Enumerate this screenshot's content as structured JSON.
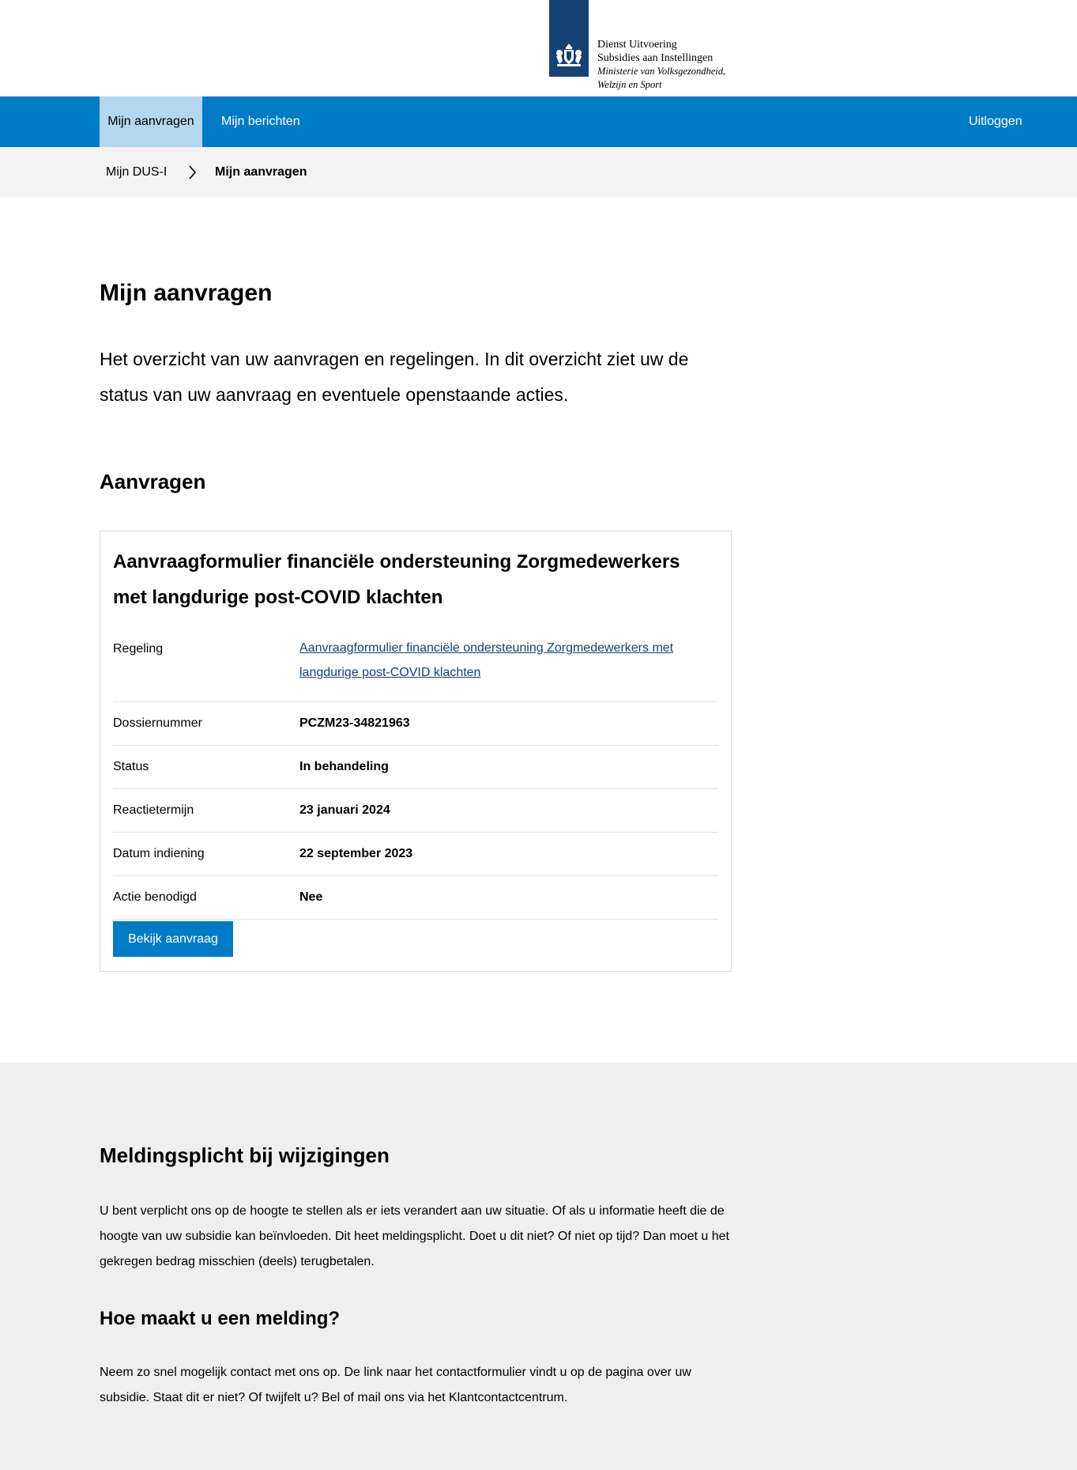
{
  "header": {
    "logo_line1": "Dienst Uitvoering",
    "logo_line2": "Subsidies aan Instellingen",
    "logo_line3": "Ministerie van Volksgezondheid,",
    "logo_line4": "Welzijn en Sport",
    "logo_icon": "crest-icon",
    "brand_color": "#154273"
  },
  "nav": {
    "items": [
      {
        "label": "Mijn aanvragen",
        "active": true
      },
      {
        "label": "Mijn berichten",
        "active": false
      }
    ],
    "logout_label": "Uitloggen",
    "bg_color": "#007bc7",
    "active_color": "#b2d7ee"
  },
  "breadcrumb": {
    "items": [
      "Mijn DUS-I",
      "Mijn aanvragen"
    ],
    "separator_icon": "chevron-right-icon"
  },
  "main": {
    "title": "Mijn aanvragen",
    "intro": "Het overzicht van uw aanvragen en regelingen. In dit overzicht ziet uw de status van uw aanvraag en eventuele openstaande acties.",
    "section_title": "Aanvragen"
  },
  "card": {
    "title": "Aanvraagformulier financiële ondersteuning Zorgmedewerkers met langdurige post-COVID klachten",
    "rows": [
      {
        "label": "Regeling",
        "value": "Aanvraagformulier financiële ondersteuning Zorgmedewerkers met langdurige post-COVID klachten"
      },
      {
        "label": "Dossiernummer",
        "value": "PCZM23-34821963"
      },
      {
        "label": "Status",
        "value": "In behandeling"
      },
      {
        "label": "Reactietermijn",
        "value": "23 januari 2024"
      },
      {
        "label": "Datum indiening",
        "value": "22 september 2023"
      },
      {
        "label": "Actie benodigd",
        "value": "Nee"
      }
    ],
    "button_label": "Bekijk aanvraag"
  },
  "info": {
    "heading1": "Meldingsplicht bij wijzigingen",
    "paragraph1": "U bent verplicht ons op de hoogte te stellen als er iets verandert aan uw situatie. Of als u informatie heeft die de hoogte van uw subsidie kan beïnvloeden. Dit heet meldingsplicht. Doet u dit niet? Of niet op tijd? Dan moet u het gekregen bedrag misschien (deels) terugbetalen.",
    "heading2": "Hoe maakt u een melding?",
    "paragraph2": "Neem zo snel mogelijk contact met ons op. De link naar het contactformulier vindt u op de pagina over uw subsidie. Staat dit er niet? Of twijfelt u? Bel of mail ons via het Klantcontactcentrum."
  }
}
